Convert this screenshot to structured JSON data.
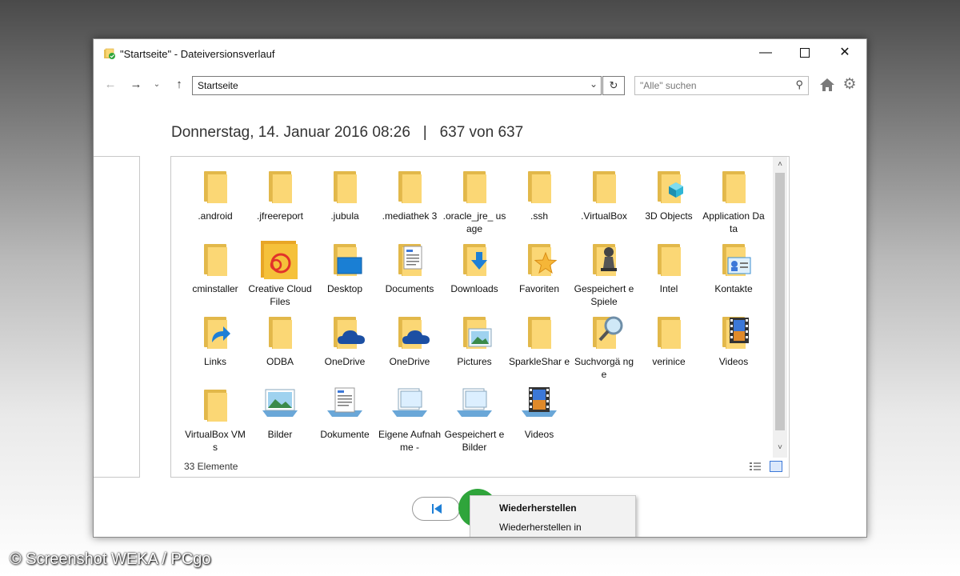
{
  "window": {
    "title": "\"Startseite\" - Dateiversionsverlauf",
    "controls": {
      "minimize": "—",
      "close": "✕"
    }
  },
  "nav": {
    "back_glyph": "←",
    "forward_glyph": "→",
    "history_glyph": "⌄",
    "up_glyph": "↑",
    "address": "Startseite",
    "address_dropdown_glyph": "⌄",
    "refresh_glyph": "↻",
    "search_placeholder": "\"Alle\" suchen",
    "search_glyph": "⚲",
    "settings_glyph": "⚙"
  },
  "header": {
    "date": "Donnerstag, 14. Januar 2016 08:26",
    "separator": "|",
    "position": "637 von 637"
  },
  "items": [
    {
      "label": ".android",
      "icon": "folder-icon"
    },
    {
      "label": ".jfreereport",
      "icon": "folder-icon"
    },
    {
      "label": ".jubula",
      "icon": "folder-icon"
    },
    {
      "label": ".mediathek 3",
      "icon": "folder-icon"
    },
    {
      "label": ".oracle_jre_ usage",
      "icon": "folder-icon"
    },
    {
      "label": ".ssh",
      "icon": "folder-icon"
    },
    {
      "label": ".VirtualBox",
      "icon": "folder-icon"
    },
    {
      "label": "3D Objects",
      "icon": "folder-3d-objects-icon"
    },
    {
      "label": "Application Data",
      "icon": "folder-icon"
    },
    {
      "label": "cminstaller",
      "icon": "folder-icon"
    },
    {
      "label": "Creative Cloud Files",
      "icon": "creative-cloud-folder-icon"
    },
    {
      "label": "Desktop",
      "icon": "folder-desktop-icon"
    },
    {
      "label": "Documents",
      "icon": "folder-documents-icon"
    },
    {
      "label": "Downloads",
      "icon": "folder-downloads-icon"
    },
    {
      "label": "Favoriten",
      "icon": "folder-favorites-icon"
    },
    {
      "label": "Gespeichert e Spiele",
      "icon": "folder-saved-games-icon"
    },
    {
      "label": "Intel",
      "icon": "folder-icon"
    },
    {
      "label": "Kontakte",
      "icon": "folder-contacts-icon"
    },
    {
      "label": "Links",
      "icon": "folder-links-icon"
    },
    {
      "label": "ODBA",
      "icon": "folder-icon"
    },
    {
      "label": "OneDrive",
      "icon": "folder-onedrive-icon"
    },
    {
      "label": "OneDrive",
      "icon": "folder-onedrive-icon"
    },
    {
      "label": "Pictures",
      "icon": "folder-pictures-icon"
    },
    {
      "label": "SparkleShar e",
      "icon": "folder-icon"
    },
    {
      "label": "Suchvorgä nge",
      "icon": "folder-searches-icon"
    },
    {
      "label": "verinice",
      "icon": "folder-icon"
    },
    {
      "label": "Videos",
      "icon": "folder-videos-icon"
    },
    {
      "label": "VirtualBox VMs",
      "icon": "folder-icon"
    },
    {
      "label": "Bilder",
      "icon": "library-pictures-icon"
    },
    {
      "label": "Dokumente",
      "icon": "library-documents-icon"
    },
    {
      "label": "Eigene Aufnahme -",
      "icon": "library-recordings-icon"
    },
    {
      "label": "Gespeichert e Bilder",
      "icon": "library-saved-pictures-icon"
    },
    {
      "label": "Videos",
      "icon": "library-videos-icon"
    }
  ],
  "status": {
    "count": "33 Elemente"
  },
  "scroll": {
    "up_glyph": "˄",
    "down_glyph": "˅"
  },
  "context_menu": {
    "items": [
      "Wiederherstellen",
      "Wiederherstellen in"
    ]
  },
  "colors": {
    "folder": "#fbd775",
    "folder_dark": "#e2b84a",
    "restore_button": "#2fa53b",
    "accent_blue": "#1e7fd6"
  },
  "watermark": "© Screenshot WEKA / PCgo"
}
